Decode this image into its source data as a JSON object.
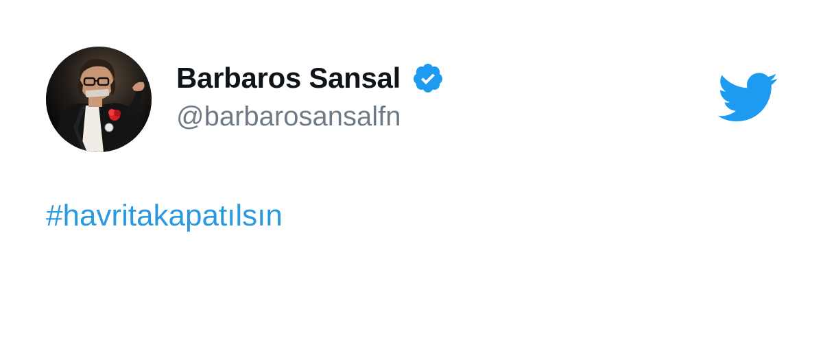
{
  "tweet": {
    "author": {
      "display_name": "Barbaros Sansal",
      "handle": "@barbarosansalfn",
      "verified": true,
      "avatar_icon": "profile-photo"
    },
    "text": {
      "hashtag": "#havritakapatılsın"
    },
    "brand_icon": "twitter-bird-icon"
  },
  "colors": {
    "brand": "#1d9bf0",
    "hashtag": "#2a99e0",
    "name": "#0f1419",
    "handle": "#6e7a86",
    "background": "#ffffff"
  }
}
